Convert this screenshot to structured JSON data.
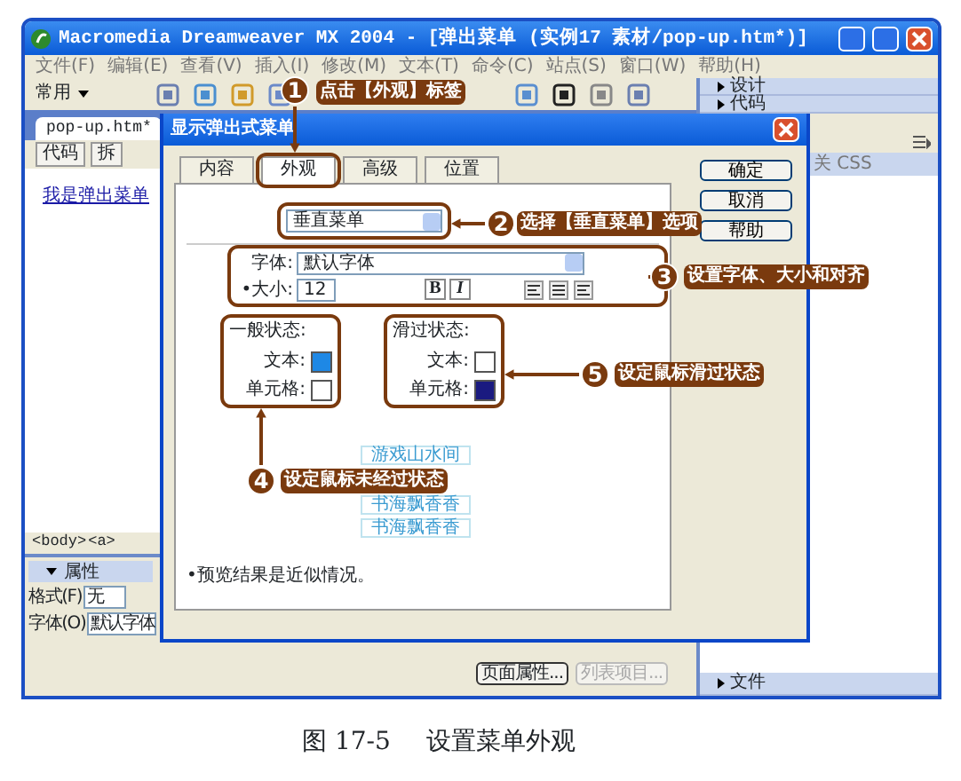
{
  "window": {
    "title": "Macromedia Dreamweaver MX 2004 - [弹出菜单 (实例17  素材/pop-up.htm*)]"
  },
  "menu": [
    "文件(F)",
    "编辑(E)",
    "查看(V)",
    "插入(I)",
    "修改(M)",
    "文本(T)",
    "命令(C)",
    "站点(S)",
    "窗口(W)",
    "帮助(H)"
  ],
  "toolbar": {
    "category": "常用"
  },
  "panel_groups": [
    {
      "label": "设计",
      "expanded": false
    },
    {
      "label": "代码",
      "expanded": false
    }
  ],
  "panel_text": "关 CSS",
  "files_panel": {
    "label": "文件",
    "expanded": false
  },
  "document": {
    "tab": "pop-up.htm*",
    "view_buttons": [
      "代码",
      "拆"
    ],
    "link_text": "我是弹出菜单",
    "tag_path": [
      "<body>",
      "<a>"
    ]
  },
  "properties": {
    "title": "属性",
    "expanded": true,
    "fields": [
      {
        "label": "格式(F)",
        "value": "无"
      },
      {
        "label": "字体(O)",
        "value": "默认字体"
      }
    ],
    "buttons": [
      {
        "label": "页面属性...",
        "disabled": false
      },
      {
        "label": "列表项目...",
        "disabled": true
      }
    ]
  },
  "dialog": {
    "title": "显示弹出式菜单",
    "tabs": [
      {
        "label": "内容",
        "selected": false
      },
      {
        "label": "外观",
        "selected": true
      },
      {
        "label": "高级",
        "selected": false
      },
      {
        "label": "位置",
        "selected": false
      }
    ],
    "menu_type": "垂直菜单",
    "font": {
      "label": "字体:",
      "value": "默认字体"
    },
    "size": {
      "label": "•大小:",
      "value": "12"
    },
    "style_buttons": [
      "B",
      "I"
    ],
    "states": [
      {
        "title": "一般状态:",
        "rows": [
          {
            "label": "文本:",
            "color": "#1e88e5"
          },
          {
            "label": "单元格:",
            "color": "#ffffff"
          }
        ]
      },
      {
        "title": "滑过状态:",
        "rows": [
          {
            "label": "文本:",
            "color": "#ffffff"
          },
          {
            "label": "单元格:",
            "color": "#1a1a80"
          }
        ]
      }
    ],
    "preview": [
      "游戏山水间",
      "书海飘香香",
      "书海飘香香"
    ],
    "note": "•预览结果是近似情况。",
    "buttons": [
      "确定",
      "取消",
      "帮助"
    ]
  },
  "callouts": [
    {
      "number": "1",
      "text": "点击【外观】标签"
    },
    {
      "number": "2",
      "text": "选择【垂直菜单】选项"
    },
    {
      "number": "3",
      "text": "设置字体、大小和对齐"
    },
    {
      "number": "4",
      "text": "设定鼠标未经过状态"
    },
    {
      "number": "5",
      "text": "设定鼠标滑过状态"
    }
  ],
  "caption": {
    "number": "图 17-5",
    "text": "设置菜单外观"
  }
}
